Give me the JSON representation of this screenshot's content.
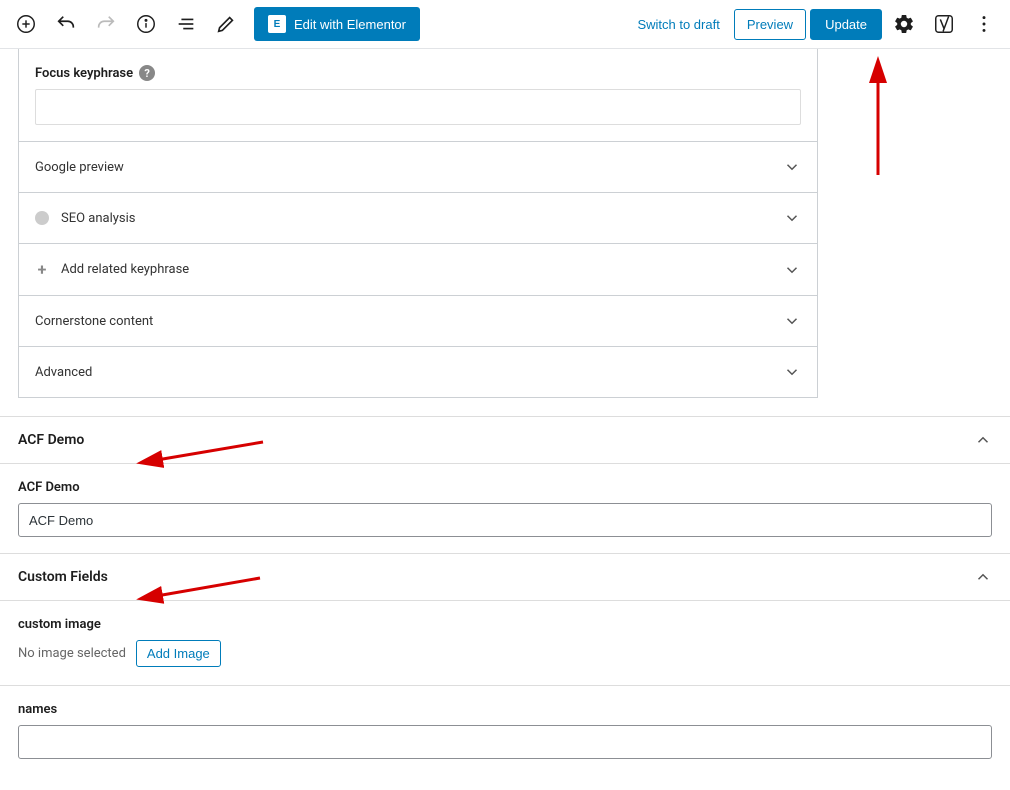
{
  "toolbar": {
    "edit_elementor_label": "Edit with Elementor",
    "switch_to_draft_label": "Switch to draft",
    "preview_label": "Preview",
    "update_label": "Update",
    "elementor_icon_text": "E"
  },
  "yoast": {
    "focus_label": "Focus keyphrase",
    "focus_value": "",
    "rows": {
      "google_preview": "Google preview",
      "seo_analysis": "SEO analysis",
      "add_related": "Add related keyphrase",
      "cornerstone": "Cornerstone content",
      "advanced": "Advanced"
    }
  },
  "acf_panel": {
    "title": "ACF Demo",
    "field_label": "ACF Demo",
    "field_value": "ACF Demo"
  },
  "custom_fields_panel": {
    "title": "Custom Fields",
    "custom_image_label": "custom image",
    "no_image_text": "No image selected",
    "add_image_label": "Add Image",
    "names_label": "names",
    "names_value": ""
  }
}
